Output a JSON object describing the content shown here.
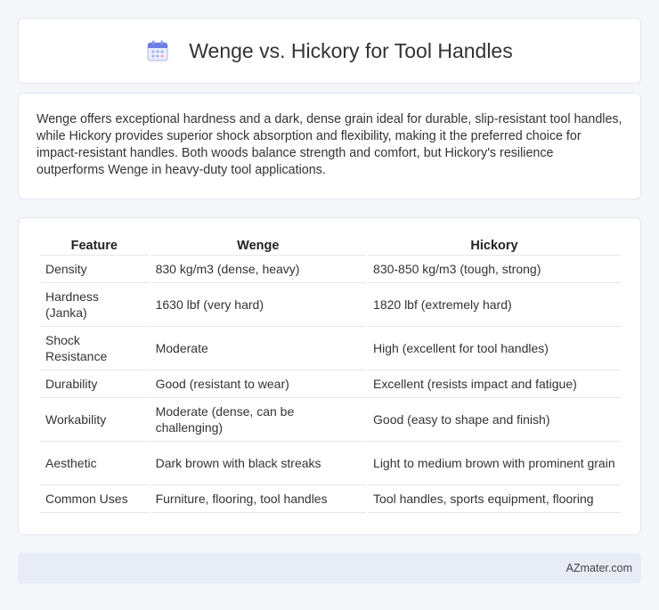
{
  "header": {
    "title": "Wenge vs. Hickory for Tool Handles",
    "icon": "calendar-icon"
  },
  "summary": {
    "text": "Wenge offers exceptional hardness and a dark, dense grain ideal for durable, slip-resistant tool handles, while Hickory provides superior shock absorption and flexibility, making it the preferred choice for impact-resistant handles. Both woods balance strength and comfort, but Hickory's resilience outperforms Wenge in heavy-duty tool applications."
  },
  "table": {
    "headers": [
      "Feature",
      "Wenge",
      "Hickory"
    ],
    "rows": [
      [
        "Density",
        "830 kg/m3 (dense, heavy)",
        "830-850 kg/m3 (tough, strong)"
      ],
      [
        "Hardness (Janka)",
        "1630 lbf (very hard)",
        "1820 lbf (extremely hard)"
      ],
      [
        "Shock Resistance",
        "Moderate",
        "High (excellent for tool handles)"
      ],
      [
        "Durability",
        "Good (resistant to wear)",
        "Excellent (resists impact and fatigue)"
      ],
      [
        "Workability",
        "Moderate (dense, can be challenging)",
        "Good (easy to shape and finish)"
      ],
      [
        "Aesthetic",
        "Dark brown with black streaks",
        "Light to medium brown with prominent grain"
      ],
      [
        "Common Uses",
        "Furniture, flooring, tool handles",
        "Tool handles, sports equipment, flooring"
      ]
    ]
  },
  "footer": {
    "brand": "AZmater.com"
  },
  "colors": {
    "background": "#f4f6fa",
    "card": "#ffffff",
    "footer_bg": "#e8ecf6",
    "icon_accent": "#6d7fe6"
  }
}
